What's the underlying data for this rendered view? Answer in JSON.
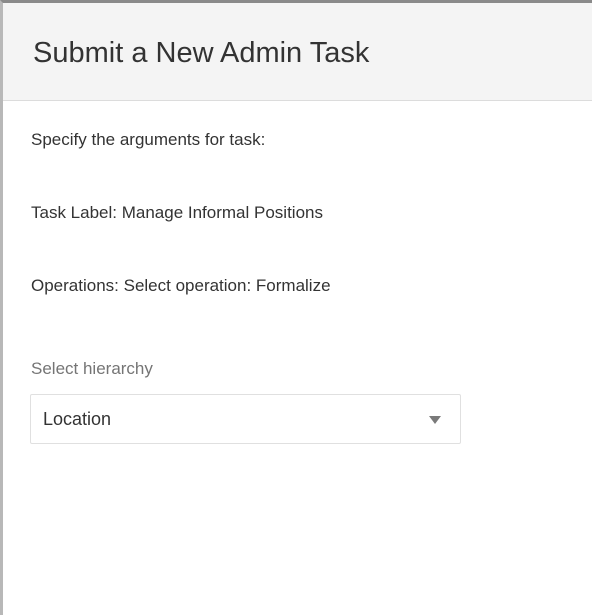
{
  "dialog": {
    "title": "Submit a New Admin Task"
  },
  "task": {
    "intro": "Specify the arguments for task:",
    "label_line": "Task Label: Manage Informal Positions",
    "operations_line": "Operations: Select operation: Formalize"
  },
  "hierarchy_field": {
    "label": "Select hierarchy",
    "selected_value": "Location",
    "icon": "chevron-down-icon"
  }
}
